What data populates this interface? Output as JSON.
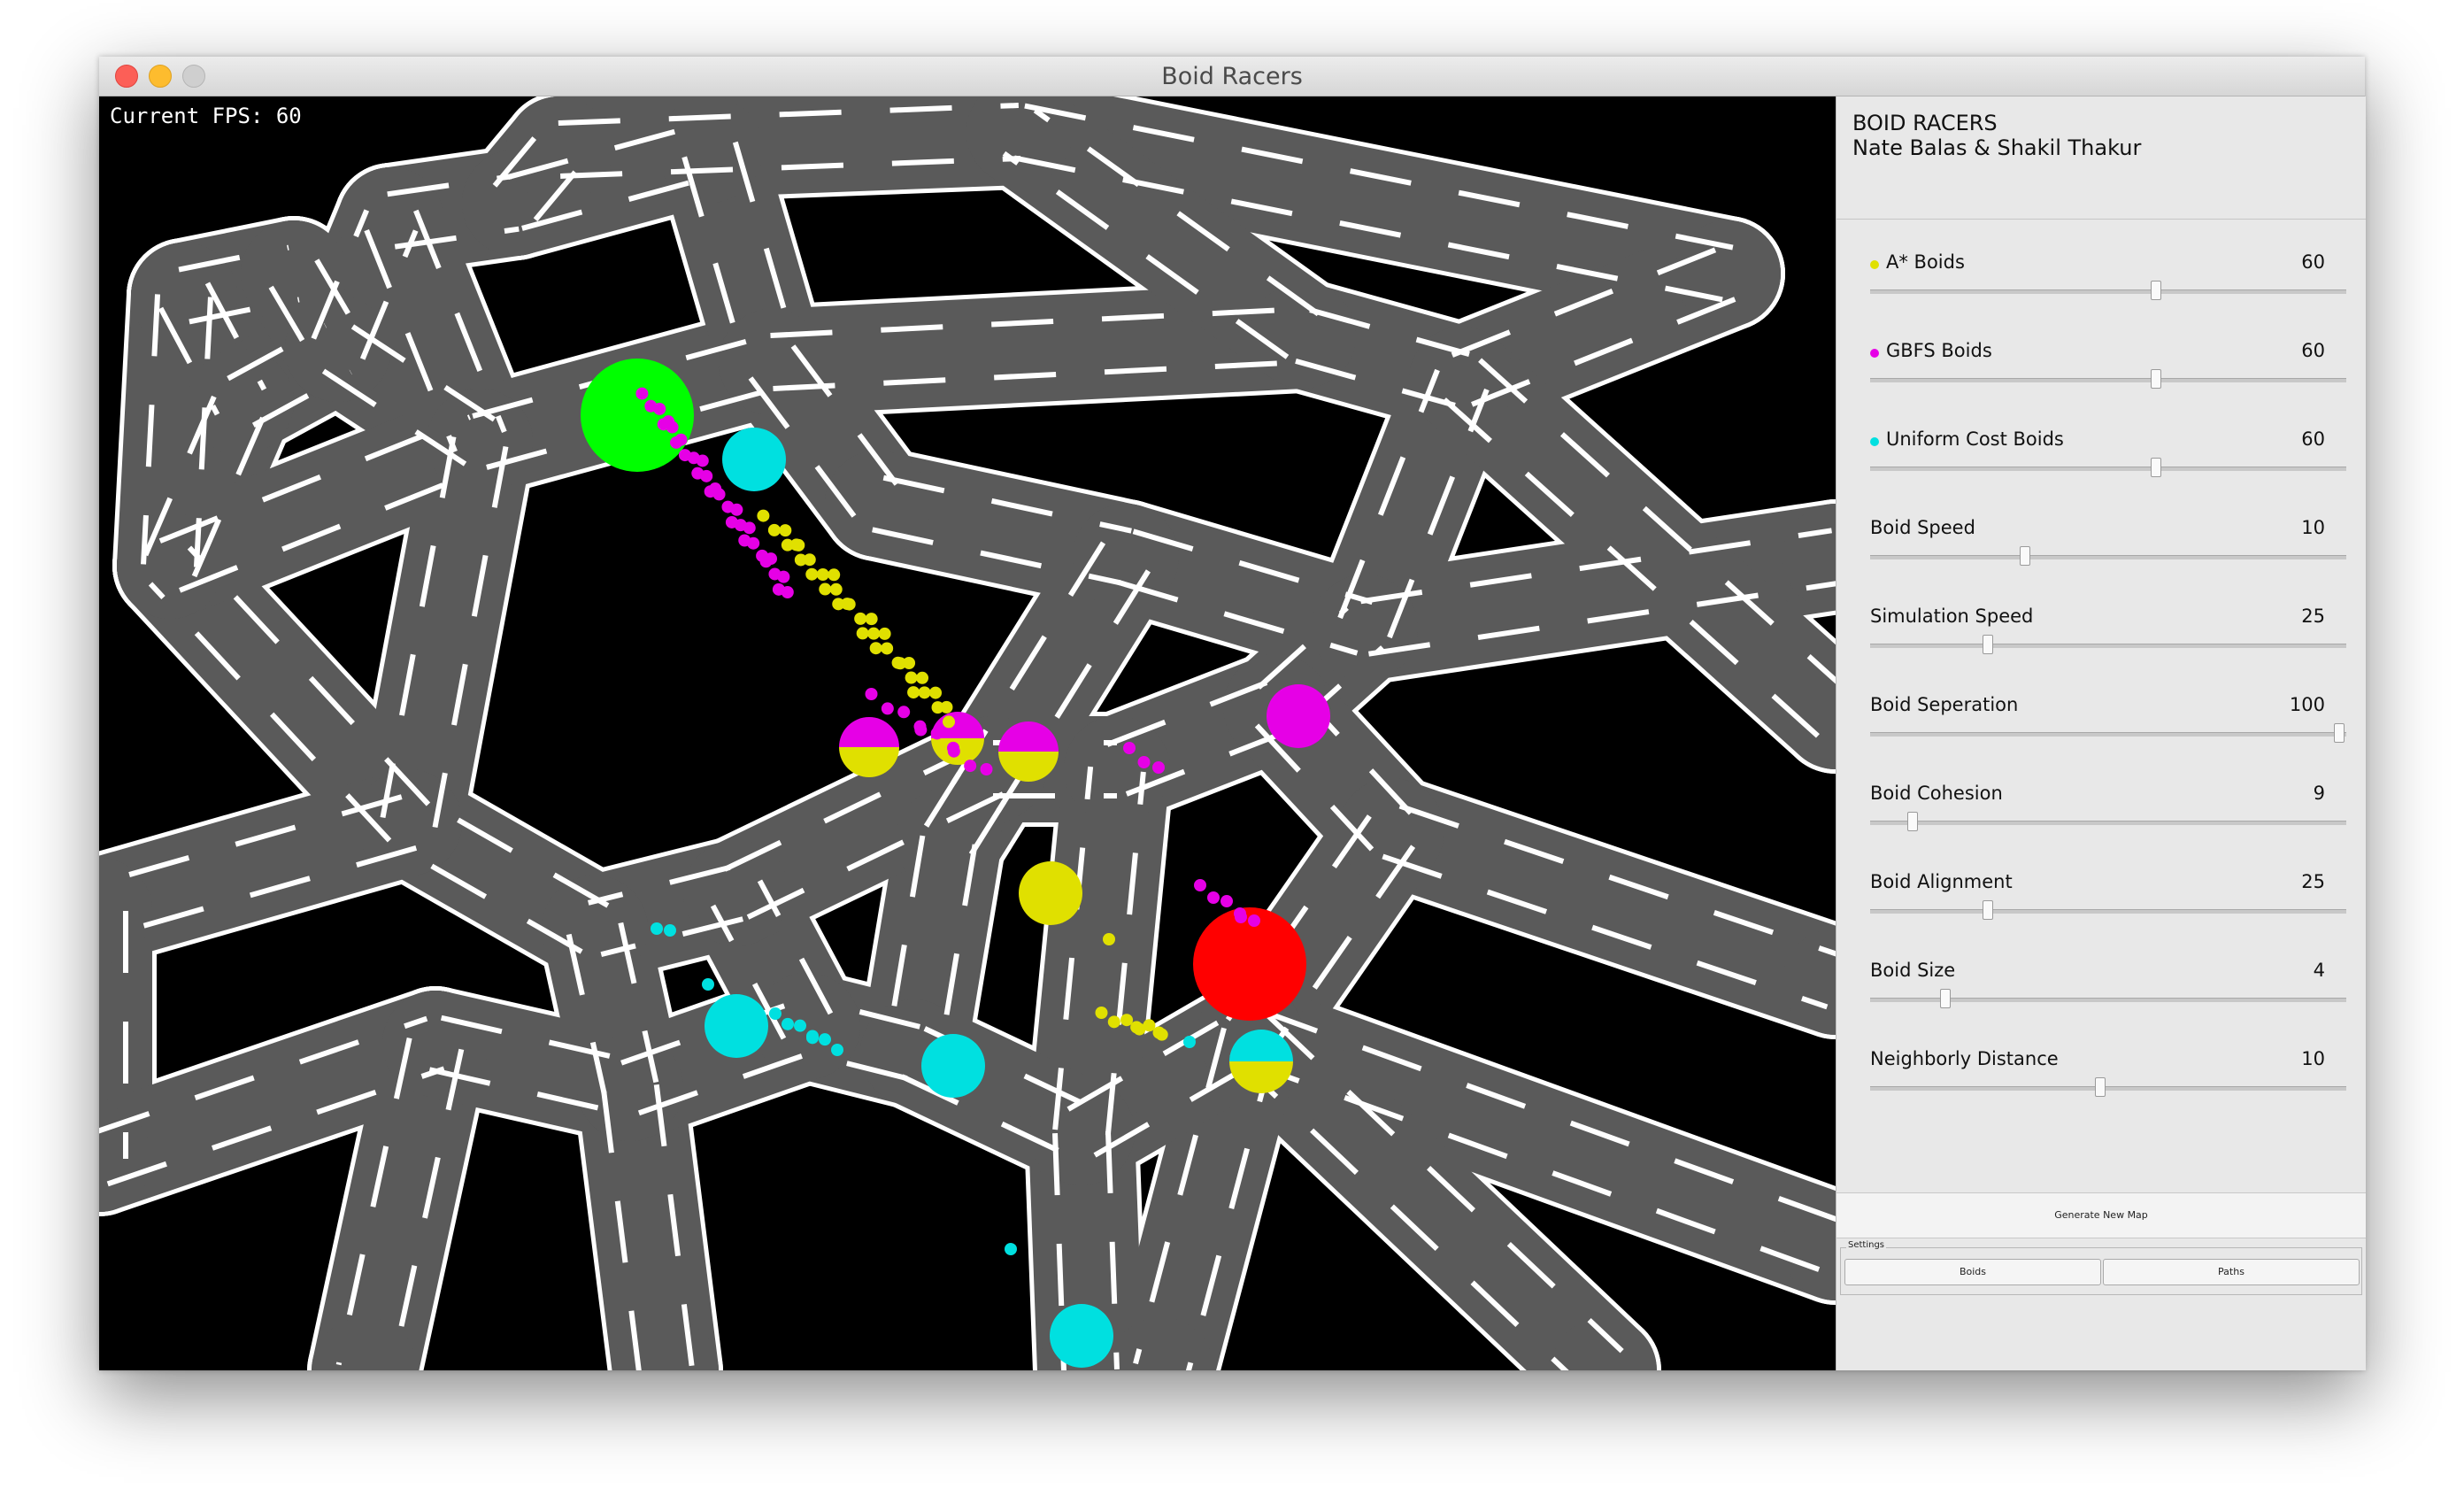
{
  "window": {
    "title": "Boid Racers"
  },
  "fps_label": "Current FPS: 60",
  "panel": {
    "title": "BOID RACERS",
    "authors": "Nate Balas & Shakil Thakur",
    "sliders": [
      {
        "label": "A* Boids",
        "value": "60",
        "fraction": 0.61,
        "dot_color": "#e0e000"
      },
      {
        "label": "GBFS Boids",
        "value": "60",
        "fraction": 0.61,
        "dot_color": "#e600e6"
      },
      {
        "label": "Uniform Cost Boids",
        "value": "60",
        "fraction": 0.61,
        "dot_color": "#00e0e0"
      },
      {
        "label": "Boid Speed",
        "value": "10",
        "fraction": 0.33,
        "dot_color": ""
      },
      {
        "label": "Simulation Speed",
        "value": "25",
        "fraction": 0.25,
        "dot_color": ""
      },
      {
        "label": "Boid Seperation",
        "value": "100",
        "fraction": 1.0,
        "dot_color": ""
      },
      {
        "label": "Boid Cohesion",
        "value": "9",
        "fraction": 0.09,
        "dot_color": ""
      },
      {
        "label": "Boid Alignment",
        "value": "25",
        "fraction": 0.25,
        "dot_color": ""
      },
      {
        "label": "Boid Size",
        "value": "4",
        "fraction": 0.16,
        "dot_color": ""
      },
      {
        "label": "Neighborly Distance",
        "value": "10",
        "fraction": 0.49,
        "dot_color": ""
      }
    ],
    "generate_button": "Generate New Map",
    "settings_legend": "Settings",
    "tabs": [
      "Boids",
      "Paths"
    ]
  },
  "colors": {
    "road": "#5a5a5a",
    "road_edge": "#ffffff",
    "start": "#00ff00",
    "goal": "#ff0000",
    "astar": "#e0e000",
    "gbfs": "#e600e6",
    "ucs": "#00e0e0"
  }
}
